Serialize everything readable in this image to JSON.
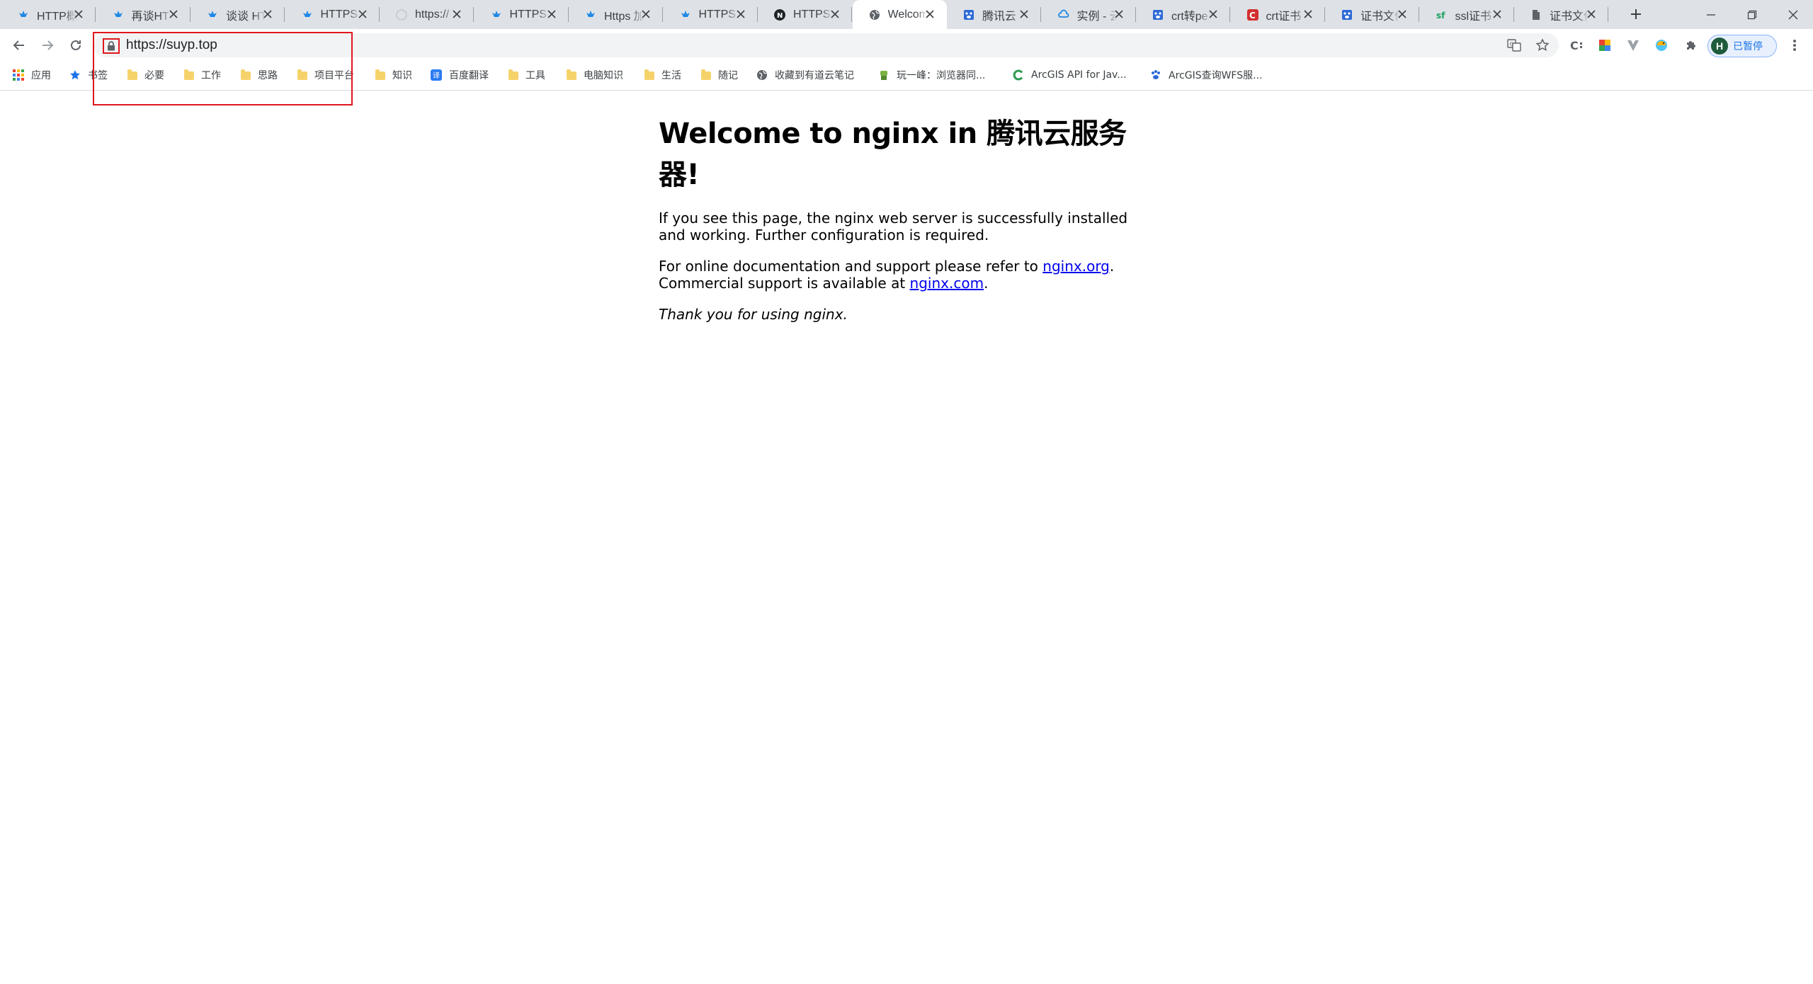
{
  "tabs": [
    {
      "title": "HTTP概",
      "favicon": "blue-bird-icon"
    },
    {
      "title": "再谈HT",
      "favicon": "blue-bird-icon"
    },
    {
      "title": "谈谈 HT",
      "favicon": "blue-bird-icon"
    },
    {
      "title": "HTTPS",
      "favicon": "blue-bird-icon"
    },
    {
      "title": "https://",
      "favicon": "github-icon"
    },
    {
      "title": "HTTPS",
      "favicon": "blue-bird-icon"
    },
    {
      "title": "Https 加",
      "favicon": "blue-bird-icon"
    },
    {
      "title": "HTTPS",
      "favicon": "blue-bird-icon"
    },
    {
      "title": "HTTPS",
      "favicon": "n-icon"
    },
    {
      "title": "Welcome",
      "favicon": "globe-icon",
      "active": true
    },
    {
      "title": "腾讯云",
      "favicon": "paw-icon"
    },
    {
      "title": "实例 - 云",
      "favicon": "cloud-icon"
    },
    {
      "title": "crt转pe",
      "favicon": "paw-icon"
    },
    {
      "title": "crt证书",
      "favicon": "c-icon"
    },
    {
      "title": "证书文件",
      "favicon": "paw-icon"
    },
    {
      "title": "ssl证书",
      "favicon": "sf-icon"
    },
    {
      "title": "证书文件",
      "favicon": "document-icon"
    }
  ],
  "address_bar": {
    "url": "https://suyp.top"
  },
  "profile": {
    "initial": "H",
    "label": "已暂停"
  },
  "bookmarks": [
    {
      "label": "应用",
      "icon": "apps-grid-icon"
    },
    {
      "label": "书签",
      "icon": "star-icon"
    },
    {
      "label": "必要",
      "icon": "folder-icon"
    },
    {
      "label": "工作",
      "icon": "folder-icon"
    },
    {
      "label": "思路",
      "icon": "folder-icon"
    },
    {
      "label": "项目平台",
      "icon": "folder-icon"
    },
    {
      "label": "知识",
      "icon": "folder-icon"
    },
    {
      "label": "百度翻译",
      "icon": "translate-icon"
    },
    {
      "label": "工具",
      "icon": "folder-icon"
    },
    {
      "label": "电脑知识",
      "icon": "folder-icon"
    },
    {
      "label": "生活",
      "icon": "folder-icon"
    },
    {
      "label": "随记",
      "icon": "folder-icon"
    },
    {
      "label": "收藏到有道云笔记",
      "icon": "globe-icon"
    },
    {
      "label": "玩一峰：浏览器同...",
      "icon": "android-icon"
    },
    {
      "label": "ArcGIS API for Jav...",
      "icon": "c-green-icon"
    },
    {
      "label": "ArcGIS查询WFS服...",
      "icon": "paw-icon"
    }
  ],
  "page": {
    "heading": "Welcome to nginx in 腾讯云服务器!",
    "p1": "If you see this page, the nginx web server is successfully installed and working. Further configuration is required.",
    "p2_pre": "For online documentation and support please refer to ",
    "p2_link1": "nginx.org",
    "p2_mid": ".",
    "p2_line2": "Commercial support is available at ",
    "p2_link2": "nginx.com",
    "p2_end": ".",
    "thanks": "Thank you for using nginx."
  },
  "colors": {
    "accent": "#1a73e8",
    "highlight": "#e0161e",
    "tabstrip": "#dee1e6"
  }
}
